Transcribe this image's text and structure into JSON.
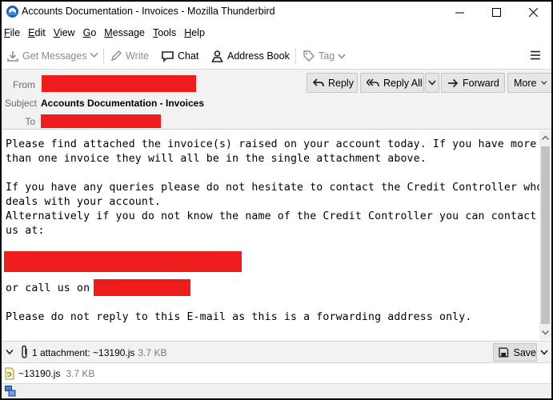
{
  "window": {
    "title": "Accounts Documentation - Invoices - Mozilla Thunderbird"
  },
  "menu": [
    "File",
    "Edit",
    "View",
    "Go",
    "Message",
    "Tools",
    "Help"
  ],
  "toolbar": {
    "get_messages": "Get Messages",
    "write": "Write",
    "chat": "Chat",
    "address_book": "Address Book",
    "tag": "Tag"
  },
  "header": {
    "from_label": "From",
    "subject_label": "Subject",
    "to_label": "To",
    "subject": "Accounts Documentation - Invoices",
    "reply": "Reply",
    "reply_all": "Reply All",
    "forward": "Forward",
    "more": "More"
  },
  "body": {
    "lines": [
      "Please find attached the invoice(s) raised on your account today. If you have more",
      "than one invoice they will all be in the single attachment above.",
      "",
      "If you have any queries please do not hesitate to contact the Credit Controller who",
      "deals with your account.",
      "Alternatively if you do not know the name of the Credit Controller you can contact",
      "us at:",
      "",
      "",
      "or call us on",
      "",
      "Please do not reply to this E-mail as this is a forwarding address only."
    ]
  },
  "attachments": {
    "summary": "1 attachment: ~13190.js",
    "summary_size": "3.7 KB",
    "save_label": "Save",
    "items": [
      {
        "name": "~13190.js",
        "size": "3.7 KB"
      }
    ]
  },
  "colors": {
    "redaction": "#ee1c1c",
    "header_bg": "#f2f2f2",
    "button_bg": "#e6e6e6"
  }
}
